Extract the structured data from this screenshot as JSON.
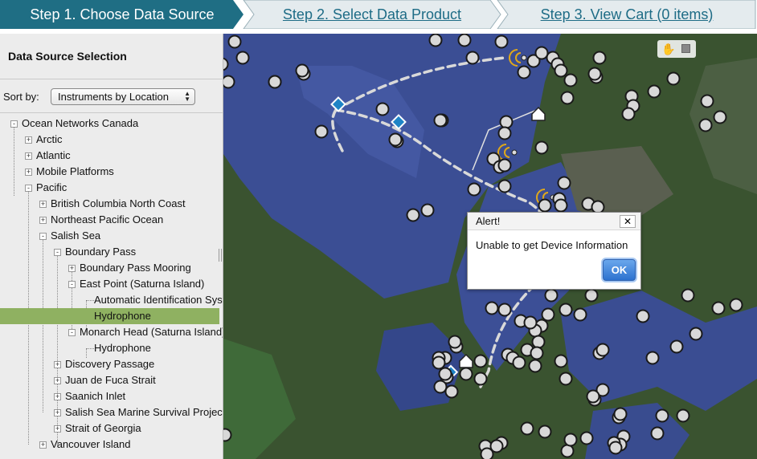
{
  "steps": [
    {
      "label": "Step 1. Choose Data Source",
      "active": true
    },
    {
      "label": "Step 2. Select Data Product",
      "active": false
    },
    {
      "label": "Step 3. View Cart (0 items)",
      "active": false
    }
  ],
  "colors": {
    "active_step": "#1f6e84",
    "inactive_step": "#e4ebee",
    "link": "#1e6c86",
    "selected_row": "#8fb161",
    "water": "#3c4f96",
    "land": "#3a5330"
  },
  "panel": {
    "title": "Data Source Selection",
    "sort_label": "Sort by:",
    "sort_value": "Instruments by Location"
  },
  "tree": [
    {
      "label": "Ocean Networks Canada",
      "depth": 0,
      "expander": "-"
    },
    {
      "label": "Arctic",
      "depth": 1,
      "expander": "+"
    },
    {
      "label": "Atlantic",
      "depth": 1,
      "expander": "+"
    },
    {
      "label": "Mobile Platforms",
      "depth": 1,
      "expander": "+"
    },
    {
      "label": "Pacific",
      "depth": 1,
      "expander": "-"
    },
    {
      "label": "British Columbia North Coast",
      "depth": 2,
      "expander": "+"
    },
    {
      "label": "Northeast Pacific Ocean",
      "depth": 2,
      "expander": "+"
    },
    {
      "label": "Salish Sea",
      "depth": 2,
      "expander": "-"
    },
    {
      "label": "Boundary Pass",
      "depth": 3,
      "expander": "-"
    },
    {
      "label": "Boundary Pass Mooring",
      "depth": 4,
      "expander": "+"
    },
    {
      "label": "East Point (Saturna Island)",
      "depth": 4,
      "expander": "-"
    },
    {
      "label": "Automatic Identification System",
      "depth": 5,
      "expander": ""
    },
    {
      "label": "Hydrophone",
      "depth": 5,
      "expander": "",
      "selected": true
    },
    {
      "label": "Monarch Head (Saturna Island)",
      "depth": 4,
      "expander": "-"
    },
    {
      "label": "Hydrophone",
      "depth": 5,
      "expander": ""
    },
    {
      "label": "Discovery Passage",
      "depth": 3,
      "expander": "+"
    },
    {
      "label": "Juan de Fuca Strait",
      "depth": 3,
      "expander": "+"
    },
    {
      "label": "Saanich Inlet",
      "depth": 3,
      "expander": "+"
    },
    {
      "label": "Salish Sea Marine Survival Project",
      "depth": 3,
      "expander": "+"
    },
    {
      "label": "Strait of Georgia",
      "depth": 3,
      "expander": "+"
    },
    {
      "label": "Vancouver Island",
      "depth": 2,
      "expander": "+"
    }
  ],
  "map": {
    "tools": {
      "pan": "hand-pan-icon",
      "zoom_box": "box-zoom-icon"
    }
  },
  "dialog": {
    "title": "Alert!",
    "close": "✕",
    "message": "Unable to get Device Information",
    "ok": "OK"
  }
}
